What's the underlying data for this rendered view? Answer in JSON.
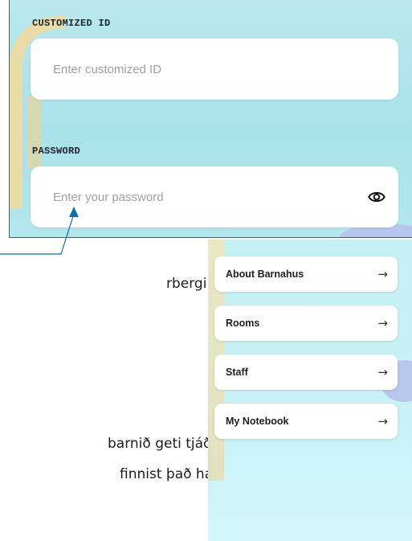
{
  "login": {
    "customized_id_label": "CUSTOMIZED ID",
    "customized_id_placeholder": "Enter customized ID",
    "password_label": "PASSWORD",
    "password_placeholder": "Enter your password",
    "show_password_icon": "eye-icon"
  },
  "document": {
    "lines": [
      "rbergi, starfsfólk",
      "barnið geti tjáð",
      "finnist það hafa"
    ]
  },
  "menu": {
    "items": [
      {
        "label": "About Barnahus",
        "arrow": "→"
      },
      {
        "label": "Rooms",
        "arrow": "→"
      },
      {
        "label": "Staff",
        "arrow": "→"
      },
      {
        "label": "My Notebook",
        "arrow": "→"
      }
    ]
  },
  "colors": {
    "annotation_line": "#0f6fa8",
    "login_background": "#b9e8ee",
    "menu_background": "#c8f2f6"
  }
}
